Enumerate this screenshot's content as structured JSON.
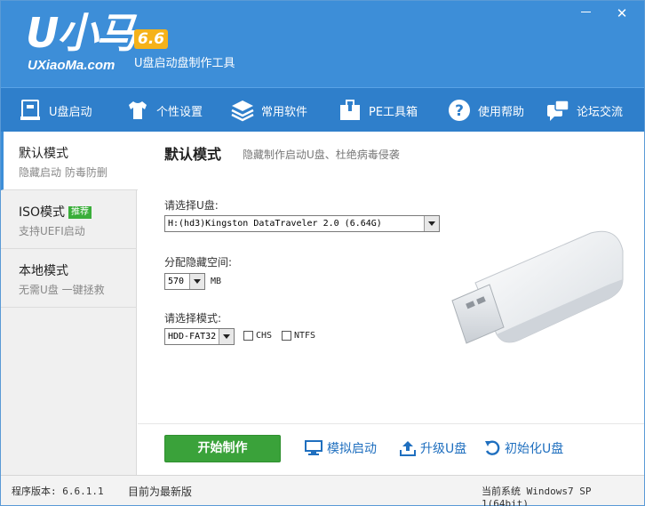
{
  "app": {
    "logo_text": "U小马",
    "version_badge": "6.6",
    "site": "UXiaoMa.com",
    "tagline": "U盘启动盘制作工具"
  },
  "toolbar": {
    "items": [
      {
        "label": "U盘启动",
        "icon": "usb-drive-icon"
      },
      {
        "label": "个性设置",
        "icon": "tshirt-icon"
      },
      {
        "label": "常用软件",
        "icon": "layers-icon"
      },
      {
        "label": "PE工具箱",
        "icon": "toolbox-icon"
      },
      {
        "label": "使用帮助",
        "icon": "help-icon"
      },
      {
        "label": "论坛交流",
        "icon": "chat-icon"
      }
    ]
  },
  "sidebar": {
    "modes": [
      {
        "title": "默认模式",
        "subtitle": "隐藏启动 防毒防删",
        "badge": ""
      },
      {
        "title": "ISO模式",
        "subtitle": "支持UEFI启动",
        "badge": "推荐"
      },
      {
        "title": "本地模式",
        "subtitle": "无需U盘 一键拯救",
        "badge": ""
      }
    ]
  },
  "main": {
    "title": "默认模式",
    "subtitle": "隐藏制作启动U盘、杜绝病毒侵袭",
    "select_usb_label": "请选择U盘:",
    "usb_value": "H:(hd3)Kingston DataTraveler 2.0 (6.64G)",
    "hidden_space_label": "分配隐藏空间:",
    "hidden_space_value": "570",
    "hidden_space_unit": "MB",
    "select_mode_label": "请选择模式:",
    "mode_value": "HDD-FAT32",
    "chs_label": "CHS",
    "ntfs_label": "NTFS",
    "chs_checked": false,
    "ntfs_checked": false
  },
  "actions": {
    "start": "开始制作",
    "simulate": "模拟启动",
    "upgrade": "升级U盘",
    "init": "初始化U盘"
  },
  "status": {
    "version": "程序版本: 6.6.1.1",
    "latest": "目前为最新版",
    "system": "当前系统 Windows7 SP 1(64bit)"
  },
  "colors": {
    "header_blue": "#3d8ed8",
    "toolbar_blue": "#2f7fcb",
    "accent_green": "#3aa23a",
    "link_blue": "#1f6fbf",
    "badge_orange": "#f5b21a"
  }
}
